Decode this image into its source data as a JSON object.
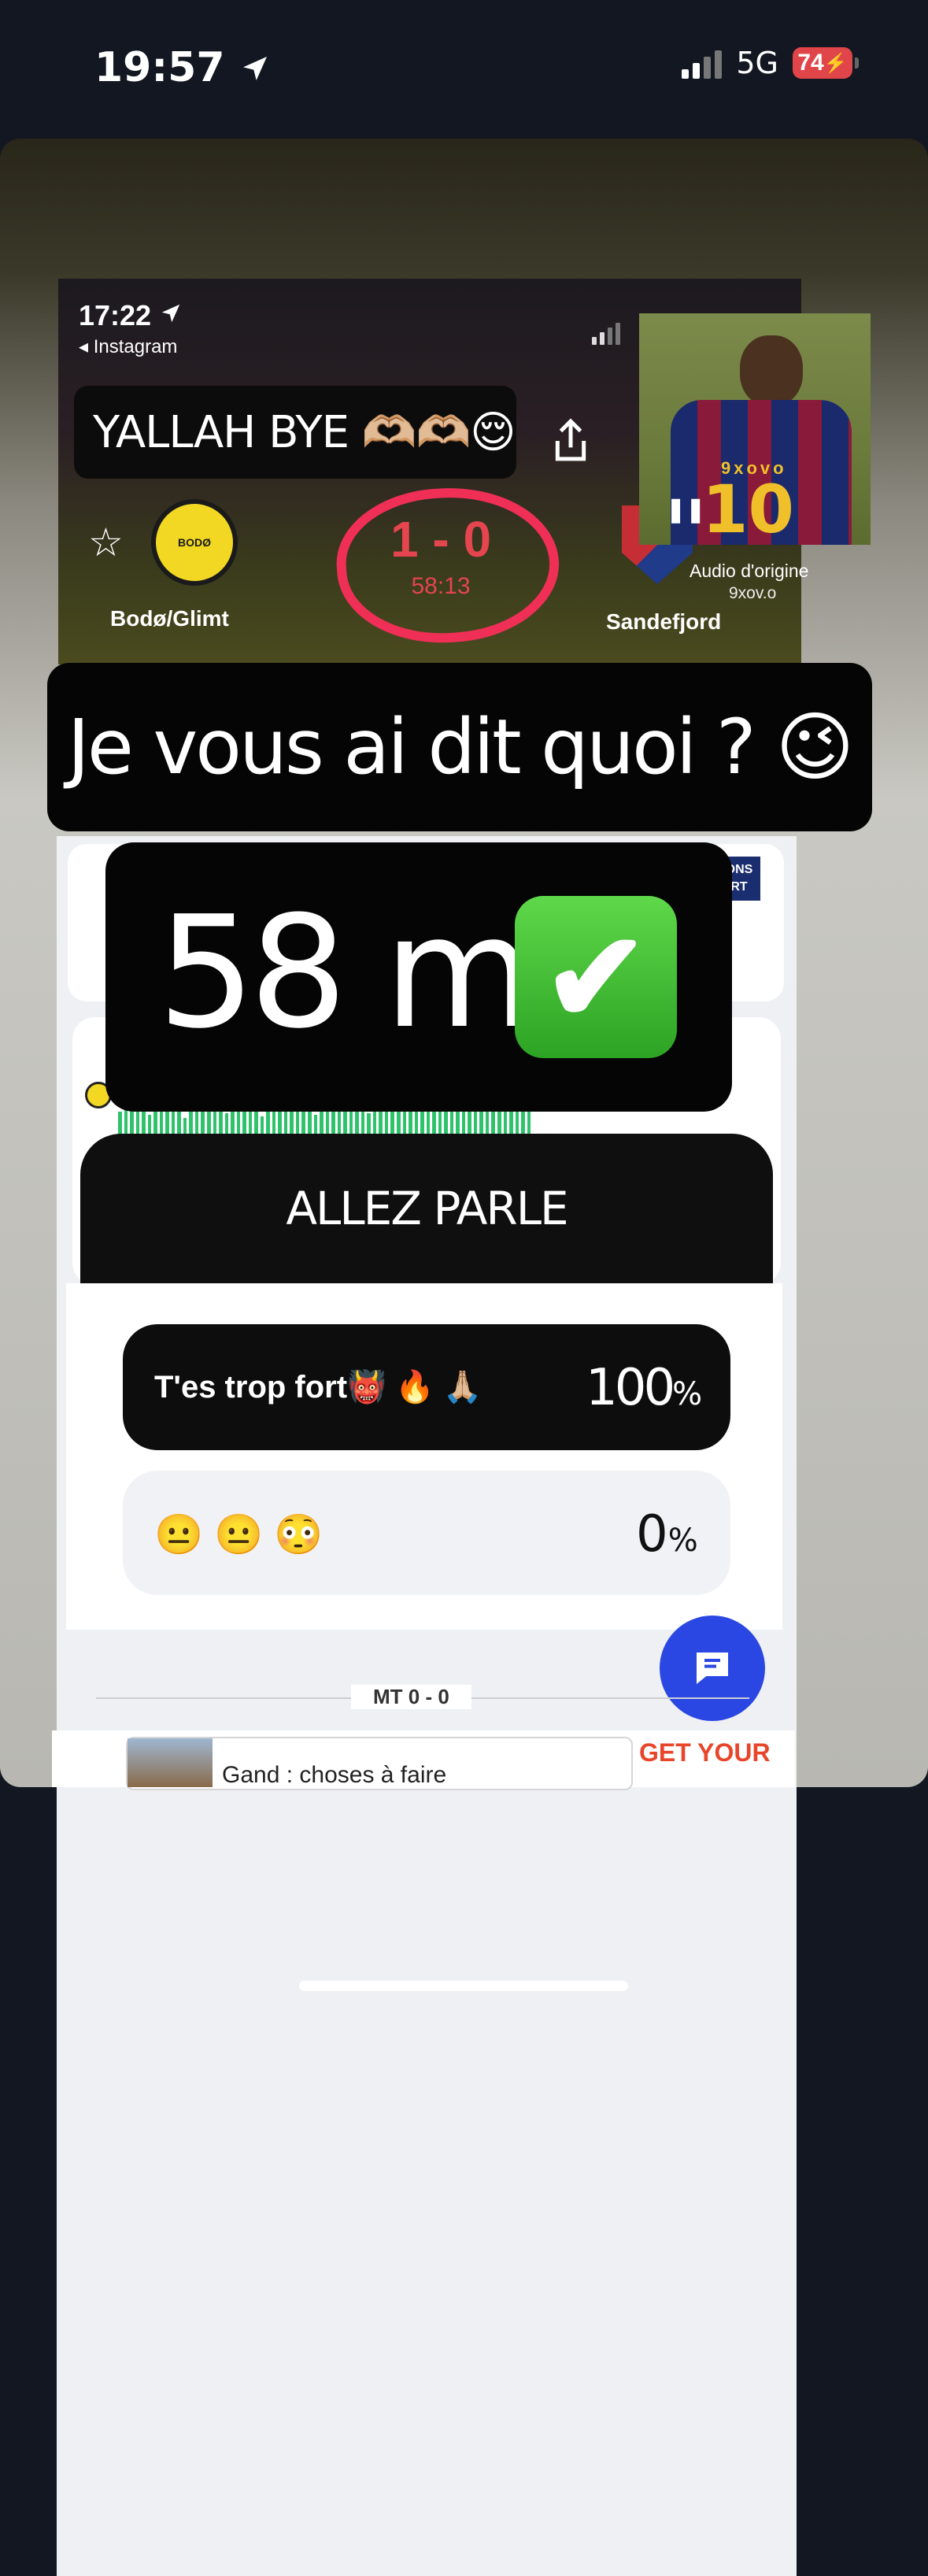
{
  "status_bar": {
    "time": "19:57",
    "network": "5G",
    "battery": "74"
  },
  "story": {
    "embedded_screenshot": {
      "time": "17:22",
      "back_app": "◂ Instagram",
      "caption_sticker": "YALLAH BYE 🫶🏼🫶🏼😌",
      "home_team": "Bodø/Glimt",
      "away_team": "Sandefjord",
      "score": "1 - 0",
      "minute": "58:13",
      "audio_label": "Audio d'origine",
      "audio_user": "9xov.o",
      "jersey_text": "9xovo",
      "jersey_number": "10"
    },
    "text_sticker_1": "Je vous ai dit quoi ? 😉",
    "text_sticker_2": "58 min",
    "check_icon": "✔",
    "poll": {
      "question": "ALLEZ PARLE",
      "options": [
        {
          "label": "T'es trop fort👹 🔥 🙏🏼",
          "percent": "100"
        },
        {
          "label": "😐 😐 😳",
          "percent": "0"
        }
      ],
      "percent_sign": "%"
    },
    "background_page": {
      "half_time_label": "MT 0 - 0",
      "ad_text": "Gand : choses à faire",
      "ad_brand": "GET YOUR"
    }
  }
}
